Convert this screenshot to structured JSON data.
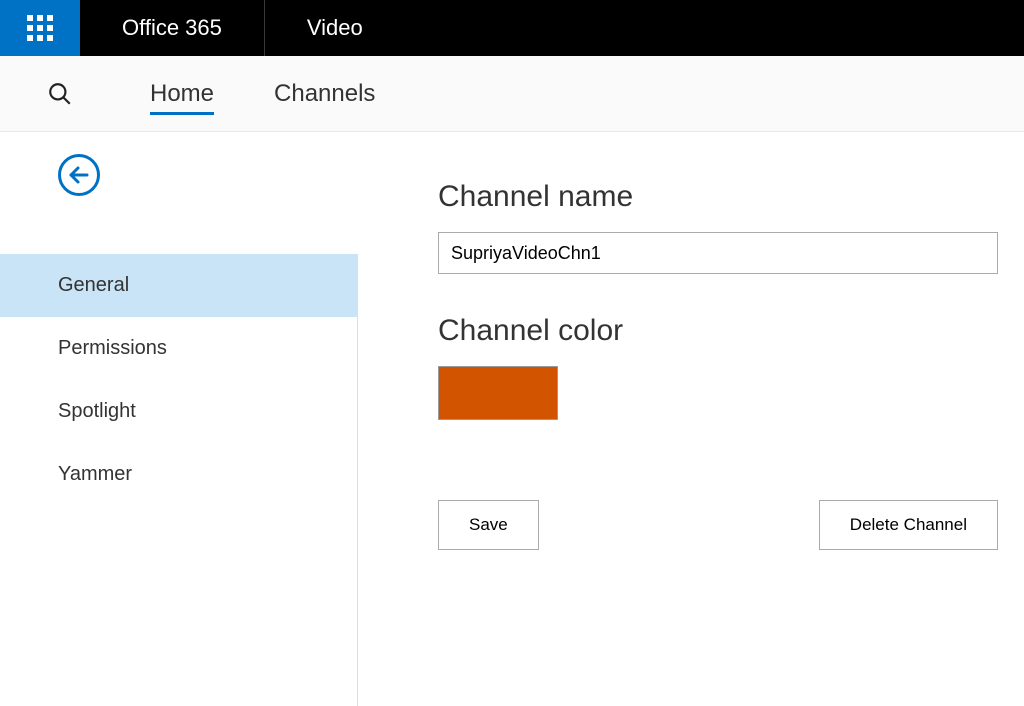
{
  "topbar": {
    "brand": "Office 365",
    "app": "Video"
  },
  "nav": {
    "home": "Home",
    "channels": "Channels"
  },
  "sidebar": {
    "items": [
      {
        "label": "General"
      },
      {
        "label": "Permissions"
      },
      {
        "label": "Spotlight"
      },
      {
        "label": "Yammer"
      }
    ]
  },
  "main": {
    "channel_name_label": "Channel name",
    "channel_name_value": "SupriyaVideoChn1",
    "channel_color_label": "Channel color",
    "channel_color_value": "#d35400",
    "save_label": "Save",
    "delete_label": "Delete Channel"
  }
}
